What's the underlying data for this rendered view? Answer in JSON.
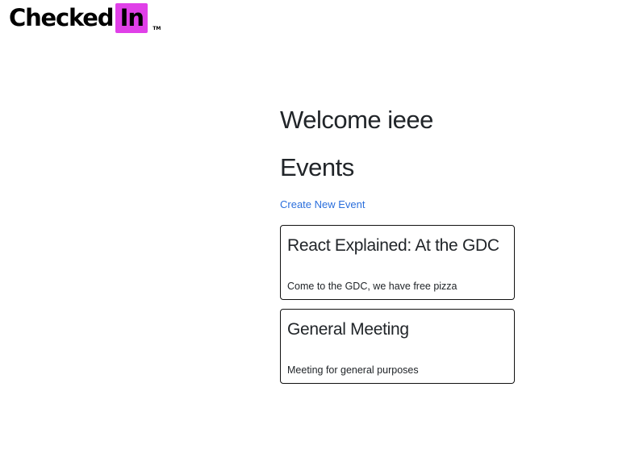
{
  "brand": {
    "logo_text": "Checked",
    "logo_highlight": "In",
    "logo_tm": "TM",
    "highlight_color": "#e040e8"
  },
  "main": {
    "welcome": "Welcome ieee",
    "events_heading": "Events",
    "create_link": "Create New Event",
    "link_color": "#2b6fdc"
  },
  "events": [
    {
      "title": "React Explained: At the GDC",
      "description": "Come to the GDC, we have free pizza"
    },
    {
      "title": "General Meeting",
      "description": "Meeting for general purposes"
    }
  ]
}
